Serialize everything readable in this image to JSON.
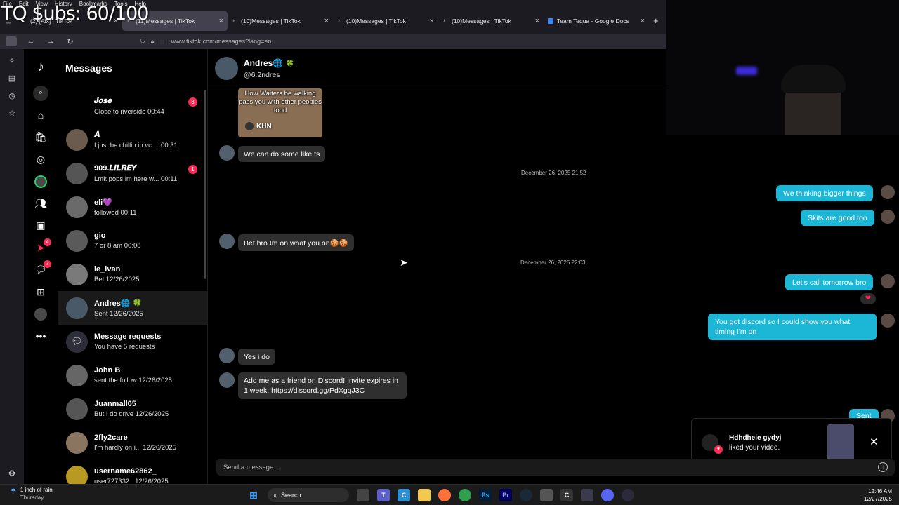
{
  "overlay": {
    "subs_text": "TQ $ubs: 60/100"
  },
  "browser": {
    "menu": [
      "File",
      "Edit",
      "View",
      "History",
      "Bookmarks",
      "Tools",
      "Help"
    ],
    "tabs": [
      {
        "title": "(2) [Aix] | TikTok",
        "icon": "tiktok-icon"
      },
      {
        "title": "(11)Messages | TikTok",
        "icon": "tiktok-icon",
        "active": true
      },
      {
        "title": "(10)Messages | TikTok",
        "icon": "tiktok-icon"
      },
      {
        "title": "(10)Messages | TikTok",
        "icon": "tiktok-icon"
      },
      {
        "title": "(10)Messages | TikTok",
        "icon": "tiktok-icon"
      },
      {
        "title": "Team Tequa - Google Docs",
        "icon": "google-docs-icon"
      }
    ],
    "url": "www.tiktok.com/messages?lang=en"
  },
  "tiktok_rail": {
    "badges": {
      "activity": "4",
      "messages": "7"
    }
  },
  "messages_panel": {
    "title": "Messages",
    "conversations": [
      {
        "name": "𝑱𝒐𝒔𝒆",
        "preview": "Close to riverside 00:44",
        "badge": "3",
        "avatar": "blank"
      },
      {
        "name": "𝑨",
        "preview": "I just be chillin in vc ... 00:31"
      },
      {
        "name": "909.𝑳𝑰𝑳𝑹𝑬𝒀",
        "preview": "Lmk pops im here w... 00:11",
        "badge": "1"
      },
      {
        "name": "eli💜",
        "preview": "followed 00:11"
      },
      {
        "name": "gio",
        "preview": "7 or 8 am 00:08"
      },
      {
        "name": "le_ivan",
        "preview": "Bet 12/26/2025"
      },
      {
        "name": "Andres🌐 🍀",
        "preview": "Sent 12/26/2025",
        "selected": true
      },
      {
        "name": "Message requests",
        "preview": "You have 5 requests",
        "avatar": "request"
      },
      {
        "name": "John B",
        "preview": "sent the follow 12/26/2025"
      },
      {
        "name": "Juanmall05",
        "preview": "But I do drive 12/26/2025"
      },
      {
        "name": "2fly2care",
        "preview": "I'm hardly on i... 12/26/2025"
      },
      {
        "name": "username62862_",
        "preview": "user727332_ 12/26/2025"
      }
    ]
  },
  "chat": {
    "name": "Andres🌐",
    "clover": "🍀",
    "handle": "@6.2ndres",
    "video_card": {
      "caption": "How Waiters be walking pass you with other peoples food",
      "author": "KHN"
    },
    "incoming": [
      "We can do some like ts",
      "Bet bro Im on what you on🍪🍪",
      "Yes i do",
      "Add me as a friend on Discord! Invite expires in 1 week: https://discord.gg/PdXgqJ3C"
    ],
    "timestamps": [
      "December 26, 2025 21:52",
      "December 26, 2025 22:03"
    ],
    "outgoing": [
      "We thinking bigger things",
      "Skits are good too",
      "Let's call tomorrow bro",
      "You got discord so I could show you what timing I'm on",
      "Sent"
    ],
    "reaction": "❤",
    "input_placeholder": "Send a message..."
  },
  "toast": {
    "name": "Hdhdheie gydyj",
    "text": "liked your video."
  },
  "taskbar": {
    "weather_main": "1 inch of rain",
    "weather_sub": "Thursday",
    "search_label": "Search",
    "time": "12:46 AM",
    "date": "12/27/2025"
  },
  "colors": {
    "accent_pink": "#fe2c55",
    "outgoing_bubble": "#1cb7d6",
    "incoming_bubble": "#2f2f2f"
  }
}
